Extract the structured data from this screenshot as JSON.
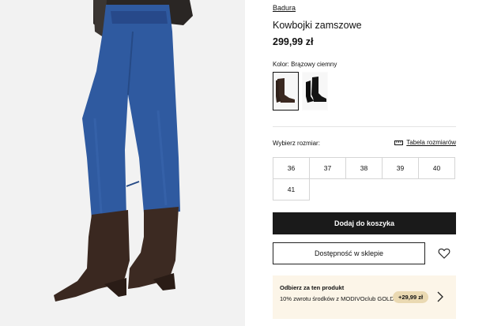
{
  "product": {
    "brand": "Badura",
    "title": "Kowbojki zamszowe",
    "price": "299,99 zł"
  },
  "color": {
    "label": "Kolor: Brązowy ciemny",
    "swatches": [
      "brown-boot-thumbnail",
      "black-boot-thumbnail"
    ]
  },
  "size": {
    "label": "Wybierz rozmiar:",
    "table_link": "Tabela rozmiarów",
    "options": [
      "36",
      "37",
      "38",
      "39",
      "40",
      "41"
    ]
  },
  "actions": {
    "add_to_cart": "Dodaj do koszyka",
    "store_availability": "Dostępność w sklepie",
    "wishlist_icon": "heart-icon"
  },
  "promo": {
    "title": "Odbierz za ten produkt",
    "description": "10% zwrotu środków z MODIVOclub GOLD",
    "badge": "+29,99 zł",
    "chevron_icon": "chevron-right-icon"
  },
  "colors": {
    "button_dark": "#1a1a1a",
    "promo_bg": "#fcf5e8",
    "badge_bg": "#ead9b2",
    "boot_brown": "#3a2820",
    "denim": "#2f5aa0"
  }
}
